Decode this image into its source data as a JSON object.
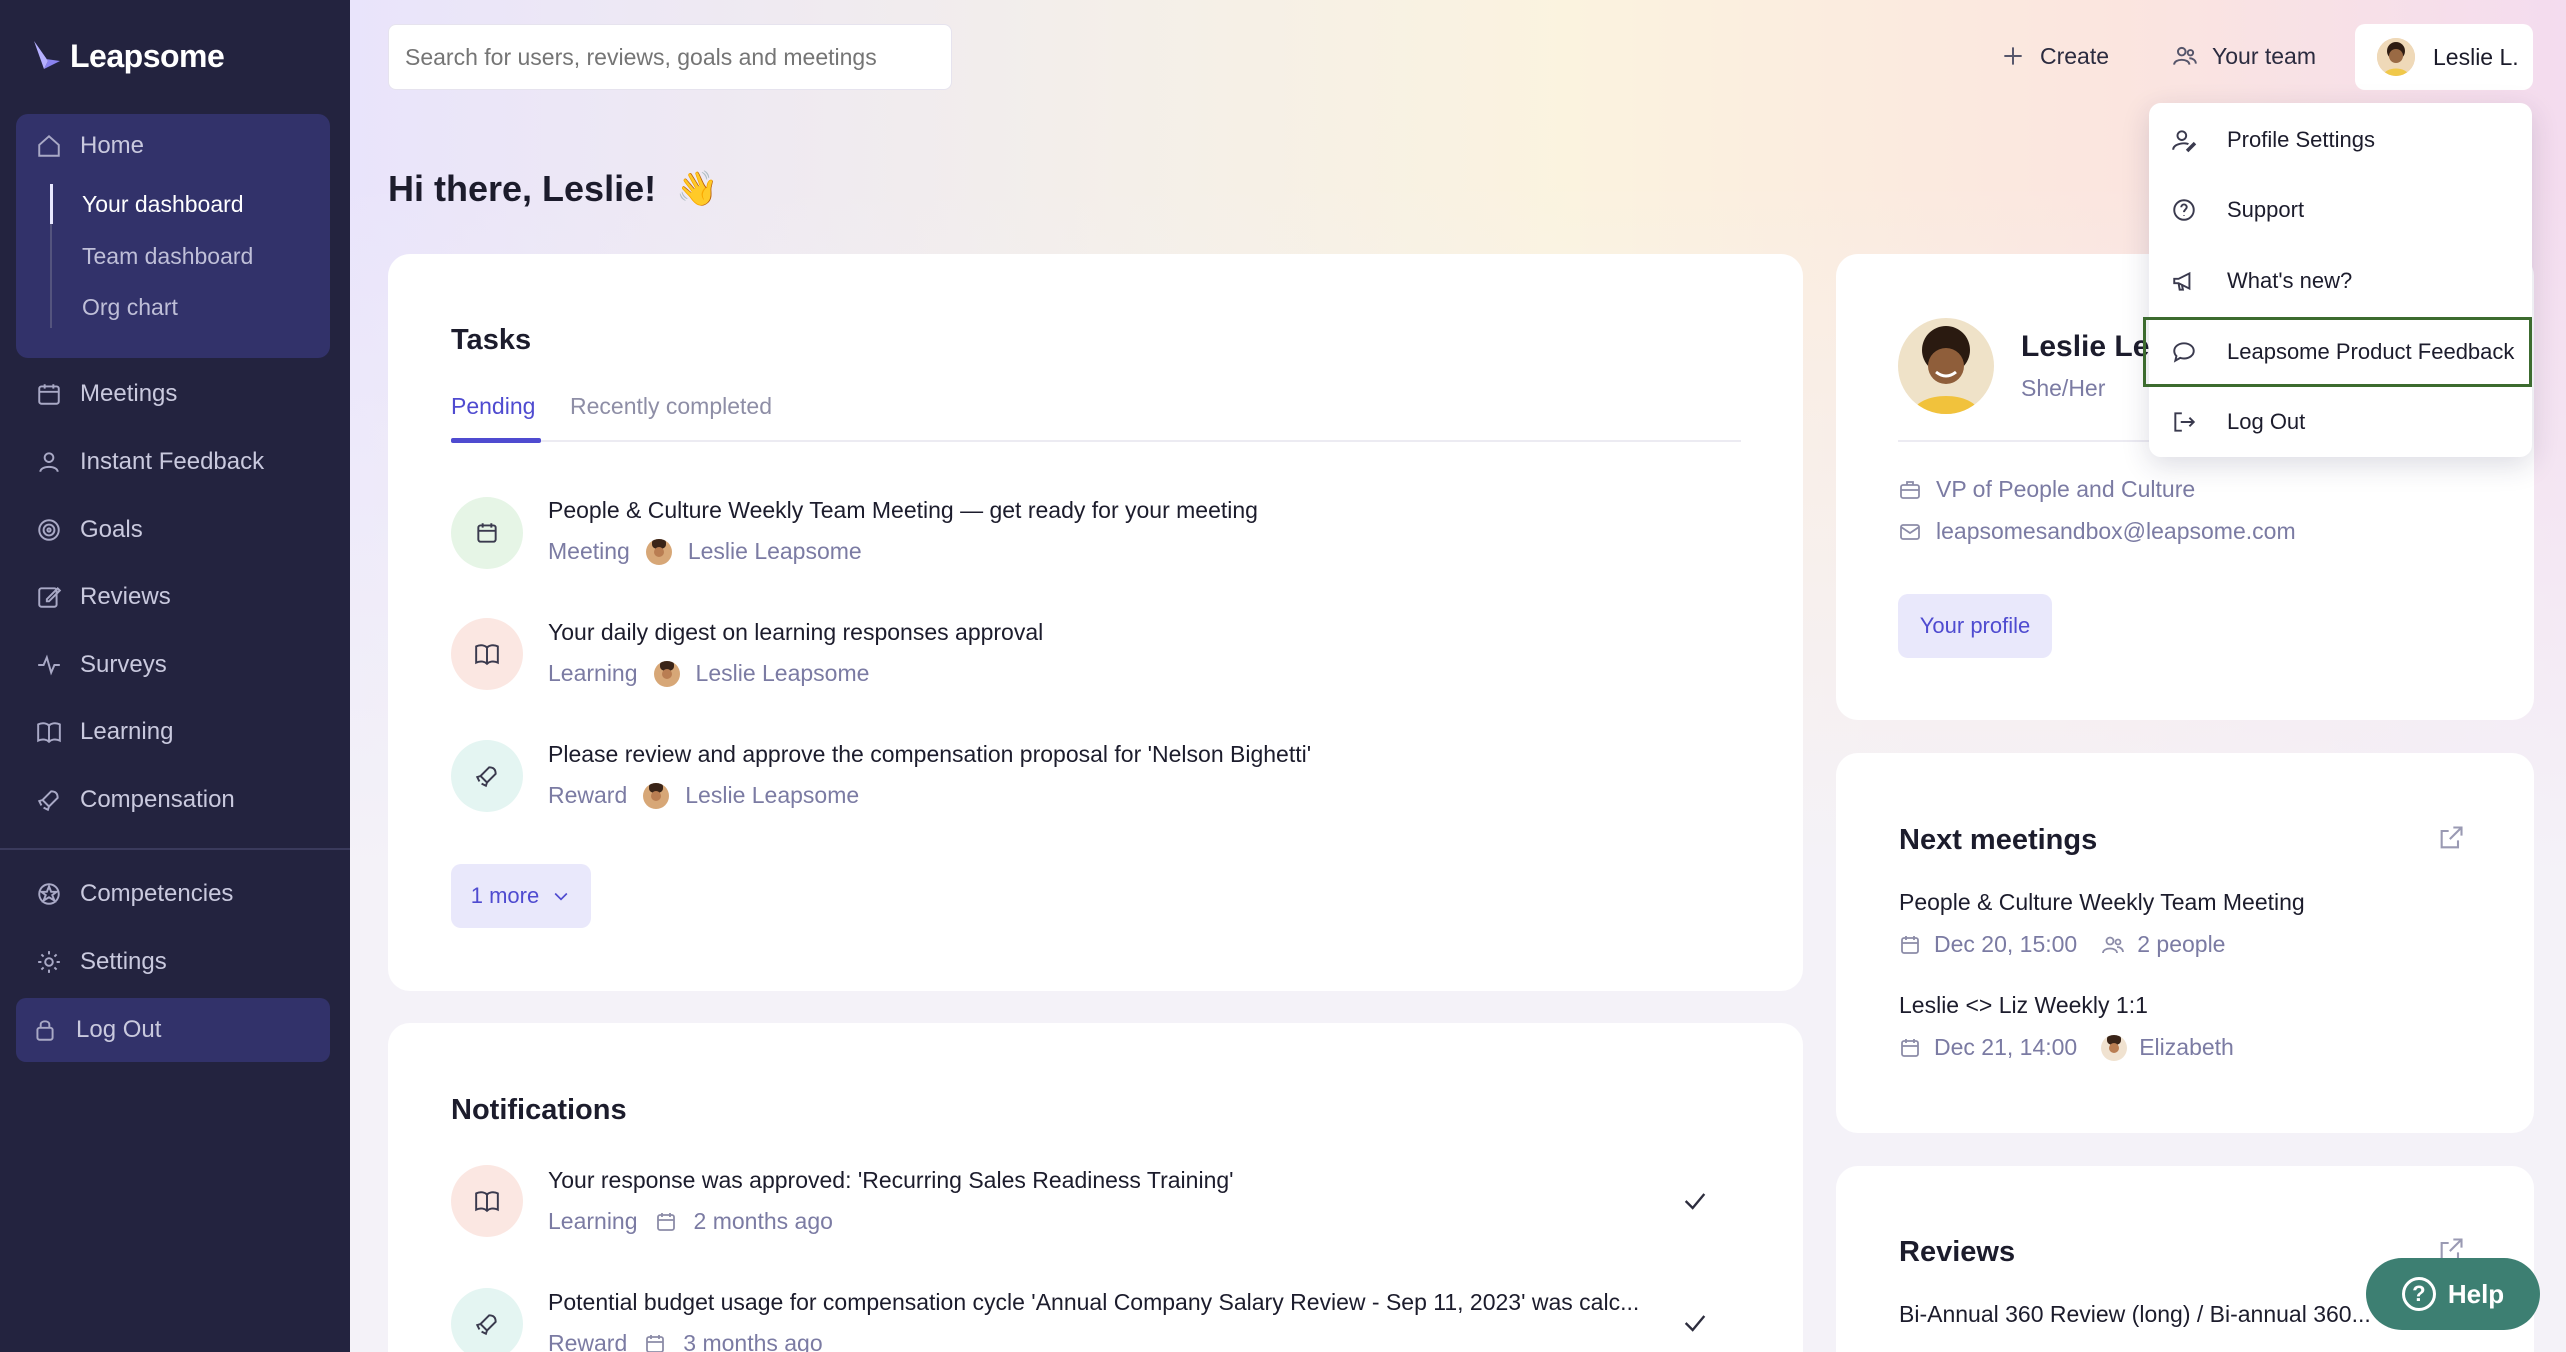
{
  "app": {
    "logo_text": "Leapsome",
    "brand_color": "#4f4bd0",
    "sidebar_color": "#23233f"
  },
  "sidebar": {
    "home": "Home",
    "sub_items": [
      "Your dashboard",
      "Team dashboard",
      "Org chart"
    ],
    "items": [
      "Meetings",
      "Instant Feedback",
      "Goals",
      "Reviews",
      "Surveys",
      "Learning",
      "Compensation"
    ],
    "lower_items": [
      "Competencies",
      "Settings"
    ],
    "logout": "Log Out"
  },
  "header": {
    "search_placeholder": "Search for users, reviews, goals and meetings",
    "create": "Create",
    "your_team": "Your team",
    "user": "Leslie L."
  },
  "greeting": {
    "text": "Hi there, Leslie!",
    "emoji": "👋"
  },
  "tasks": {
    "title": "Tasks",
    "tabs": [
      "Pending",
      "Recently completed"
    ],
    "items": [
      {
        "title": "People & Culture Weekly Team Meeting — get ready for your meeting",
        "type": "Meeting",
        "person": "Leslie Leapsome",
        "icon": "calendar-icon"
      },
      {
        "title": "Your daily digest on learning responses approval",
        "type": "Learning",
        "person": "Leslie Leapsome",
        "icon": "book-icon"
      },
      {
        "title": "Please review and approve the compensation proposal for 'Nelson Bighetti'",
        "type": "Reward",
        "person": "Leslie Leapsome",
        "icon": "rocket-icon"
      }
    ],
    "more": "1 more"
  },
  "notifications": {
    "title": "Notifications",
    "items": [
      {
        "title": "Your response was approved: 'Recurring Sales Readiness Training'",
        "type": "Learning",
        "time": "2 months ago"
      },
      {
        "title": "Potential budget usage for compensation cycle 'Annual Company Salary Review - Sep 11, 2023' was calc...",
        "type": "Reward",
        "time": "3 months ago"
      }
    ]
  },
  "profile": {
    "name": "Leslie Lea",
    "pronouns": "She/Her",
    "role": "VP of People and Culture",
    "email": "leapsomesandbox@leapsome.com",
    "button": "Your profile"
  },
  "next_meetings": {
    "title": "Next meetings",
    "items": [
      {
        "title": "People & Culture Weekly Team Meeting",
        "date": "Dec 20, 15:00",
        "attendees": "2 people"
      },
      {
        "title": "Leslie <> Liz Weekly 1:1",
        "date": "Dec 21, 14:00",
        "attendees": "Elizabeth"
      }
    ]
  },
  "reviews": {
    "title": "Reviews",
    "item": "Bi-Annual 360 Review (long) / Bi-annual 360..."
  },
  "dropdown": {
    "items": [
      "Profile Settings",
      "Support",
      "What's new?",
      "Leapsome Product Feedback",
      "Log Out"
    ]
  },
  "help": {
    "label": "Help"
  }
}
